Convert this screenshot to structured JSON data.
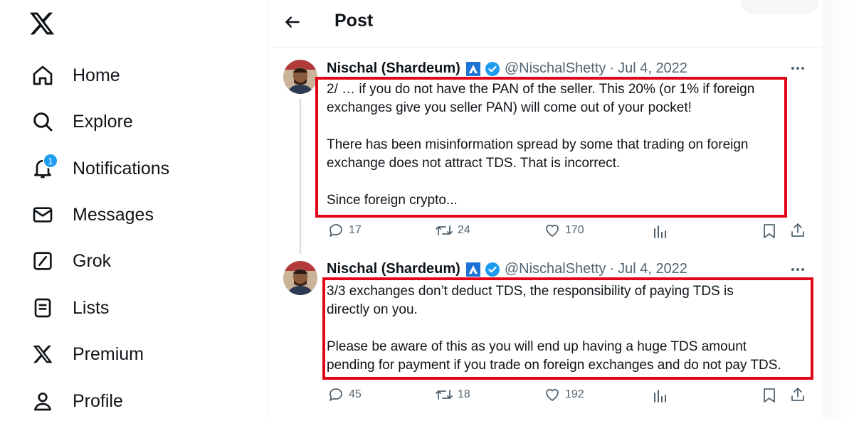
{
  "sidebar": {
    "items": [
      {
        "label": "Home",
        "icon": "home-icon"
      },
      {
        "label": "Explore",
        "icon": "search-icon"
      },
      {
        "label": "Notifications",
        "icon": "bell-icon",
        "badge": "1"
      },
      {
        "label": "Messages",
        "icon": "envelope-icon"
      },
      {
        "label": "Grok",
        "icon": "grok-icon"
      },
      {
        "label": "Lists",
        "icon": "list-icon"
      },
      {
        "label": "Premium",
        "icon": "x-logo-icon"
      },
      {
        "label": "Profile",
        "icon": "person-icon"
      }
    ]
  },
  "header": {
    "title": "Post"
  },
  "posts": [
    {
      "name": "Nischal (Shardeum)",
      "handle": "@NischalShetty",
      "dot": "·",
      "date": "Jul 4, 2022",
      "text": "2/ … if you do not have the PAN of the seller. This 20% (or 1% if foreign\nexchanges give you seller PAN) will come out of your pocket!\n\nThere has been misinformation spread by some that trading on foreign\nexchange does not attract TDS. That is incorrect.\n\nSince foreign crypto...",
      "replies": "17",
      "reposts": "24",
      "likes": "170"
    },
    {
      "name": "Nischal (Shardeum)",
      "handle": "@NischalShetty",
      "dot": "·",
      "date": "Jul 4, 2022",
      "text": "3/3 exchanges don’t deduct TDS, the responsibility of paying TDS is\ndirectly on you.\n\nPlease be aware of this as you will end up having a huge TDS amount\npending for payment if you trade on foreign exchanges and do not pay TDS.",
      "replies": "45",
      "reposts": "18",
      "likes": "192"
    }
  ],
  "colors": {
    "accent": "#1d9bf0",
    "highlight": "#e3061b",
    "muted": "#536471"
  }
}
